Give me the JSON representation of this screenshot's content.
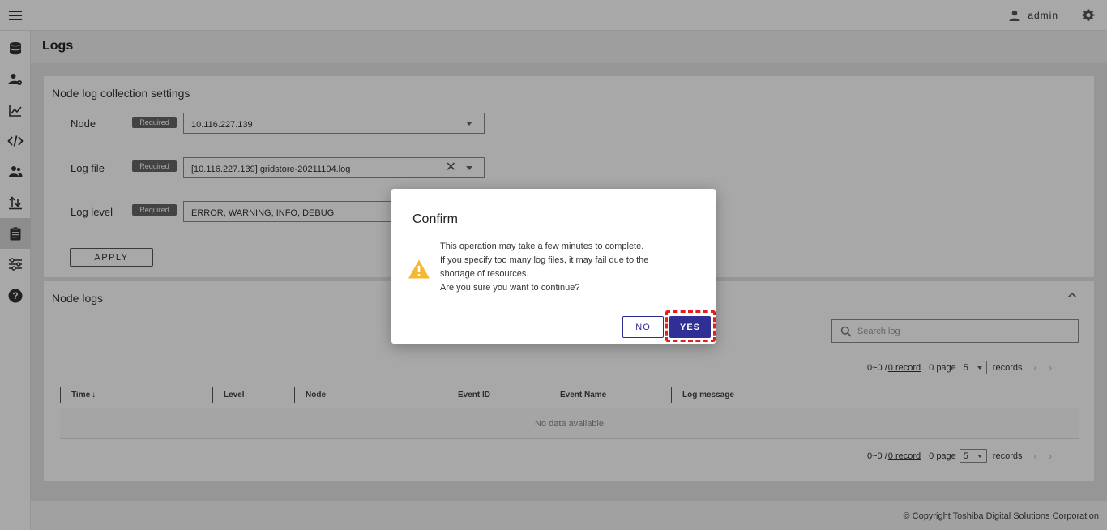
{
  "header": {
    "username": "admin",
    "icons": {
      "menu": "hamburger-icon",
      "user": "person-icon",
      "settings": "gear-icon"
    }
  },
  "sidebar": {
    "items": [
      {
        "icon": "database-icon"
      },
      {
        "icon": "user-settings-icon"
      },
      {
        "icon": "line-chart-icon"
      },
      {
        "icon": "code-icon"
      },
      {
        "icon": "users-icon"
      },
      {
        "icon": "import-export-icon"
      },
      {
        "icon": "clipboard-icon",
        "active": true
      },
      {
        "icon": "sliders-icon"
      },
      {
        "icon": "help-icon"
      }
    ]
  },
  "page": {
    "title": "Logs"
  },
  "settings": {
    "title": "Node log collection settings",
    "required_label": "Required",
    "node": {
      "label": "Node",
      "value": "10.116.227.139"
    },
    "log_file": {
      "label": "Log file",
      "value": "[10.116.227.139] gridstore-20211104.log"
    },
    "log_level": {
      "label": "Log level",
      "value": "ERROR, WARNING, INFO, DEBUG"
    },
    "apply_label": "APPLY"
  },
  "logs": {
    "title": "Node logs",
    "search_placeholder": "Search log",
    "pagination": {
      "range": "0~0 /",
      "record_link": "0 record",
      "page": "0 page",
      "page_size": "5",
      "records_label": "records",
      "prev": "‹",
      "next": "›"
    },
    "columns": [
      "Time",
      "Level",
      "Node",
      "Event ID",
      "Event Name",
      "Log message"
    ],
    "sort_indicator": "↓",
    "empty_text": "No data available"
  },
  "footer": {
    "copyright": "© Copyright Toshiba Digital Solutions Corporation"
  },
  "dialog": {
    "title": "Confirm",
    "icon": "warning-icon",
    "message_lines": [
      "This operation may take a few minutes to complete.",
      "If you specify too many log files, it may fail due to the",
      "shortage of resources.",
      "Are you sure you want to continue?"
    ],
    "no_label": "NO",
    "yes_label": "YES"
  },
  "colors": {
    "primary": "#2f2f96",
    "warning": "#f5b82e",
    "highlight": "#e0201f"
  }
}
